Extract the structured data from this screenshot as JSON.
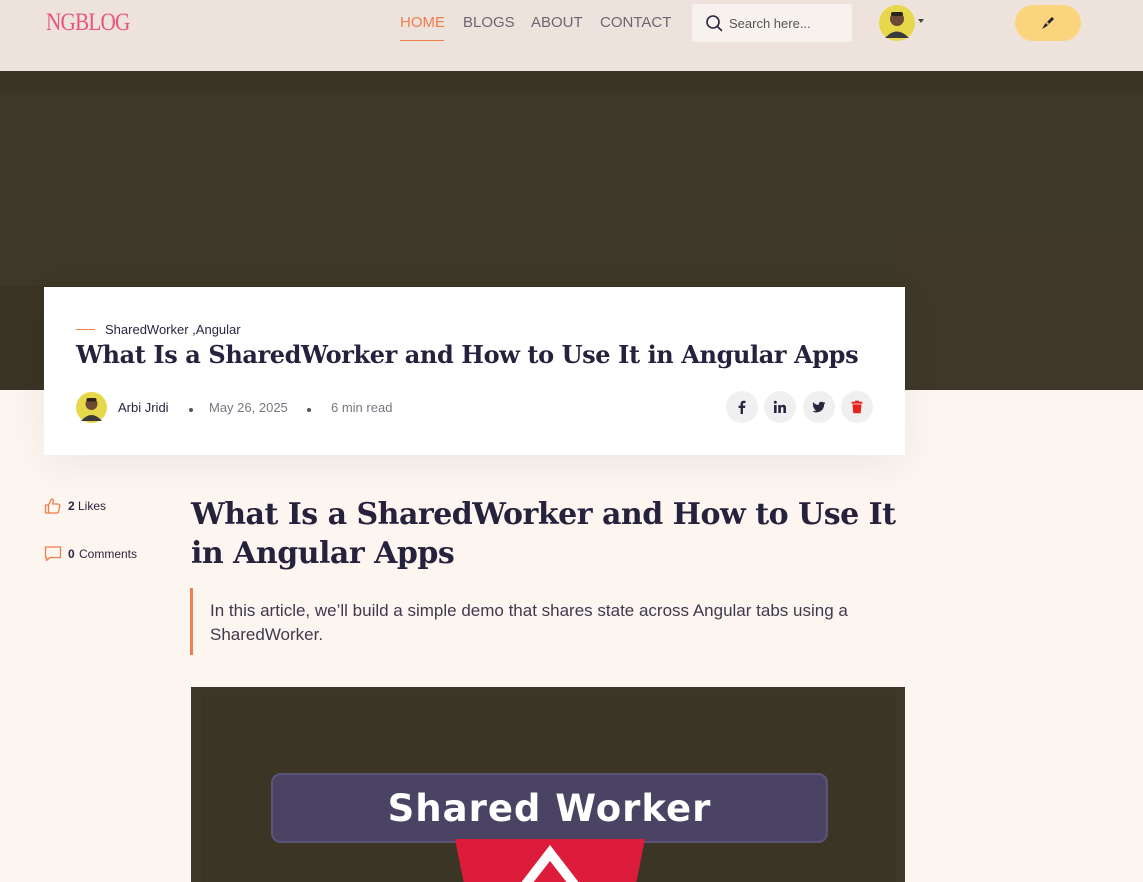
{
  "brand": {
    "logo_text": "NGBLOG",
    "accent": "#ee7e4b",
    "logo_color": "#e8557f",
    "write_button_color": "#fbd57d"
  },
  "nav": {
    "links": [
      {
        "label": "HOME",
        "active": true
      },
      {
        "label": "BLOGS",
        "active": false
      },
      {
        "label": "ABOUT",
        "active": false
      },
      {
        "label": "CONTACT",
        "active": false
      }
    ],
    "search_placeholder": "Search here...",
    "write_icon": "pen-icon",
    "avatar_icon": "user-avatar-icon"
  },
  "post": {
    "categories": "SharedWorker ,Angular",
    "title": "What Is a SharedWorker and How to Use It in Angular Apps",
    "author": "Arbi Jridi",
    "date": "May 26, 2025",
    "read_time": "6 min read",
    "share_icons": [
      "facebook-icon",
      "linkedin-icon",
      "twitter-icon",
      "trash-icon"
    ],
    "delete_color": "#e8221c"
  },
  "stats": {
    "likes_count": "2",
    "likes_label": "Likes",
    "comments_count": "0",
    "comments_label": "Comments"
  },
  "article": {
    "heading": "What Is a SharedWorker and How to Use It in Angular Apps",
    "intro": "In this article, we’ll build a simple demo that shares state across Angular tabs using a SharedWorker."
  },
  "cover": {
    "text": "Shared Worker",
    "logo": "angular-logo-icon"
  }
}
